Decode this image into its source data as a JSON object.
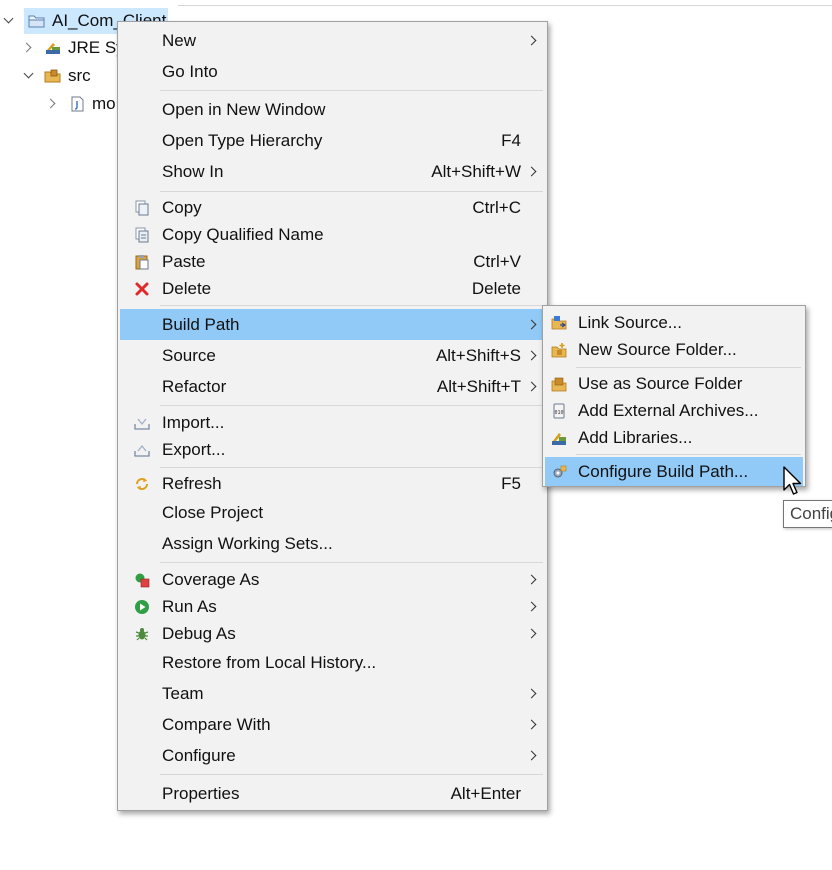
{
  "tree": {
    "items": [
      {
        "label": "AI_Com_Client",
        "expanded": true,
        "selected": true,
        "icon": "project-folder-icon"
      },
      {
        "label": "JRE Sys",
        "expanded": false,
        "icon": "jre-library-icon"
      },
      {
        "label": "src",
        "expanded": true,
        "icon": "package-folder-icon"
      },
      {
        "label": "mo",
        "expanded": false,
        "icon": "java-file-icon"
      }
    ]
  },
  "context_menu": {
    "items": [
      {
        "label": "New",
        "shortcut": "",
        "submenu": true
      },
      {
        "label": "Go Into",
        "shortcut": ""
      },
      {
        "label": "Open in New Window",
        "shortcut": ""
      },
      {
        "label": "Open Type Hierarchy",
        "shortcut": "F4"
      },
      {
        "label": "Show In",
        "shortcut": "Alt+Shift+W",
        "submenu": true
      },
      {
        "label": "Copy",
        "shortcut": "Ctrl+C",
        "icon": "copy-icon"
      },
      {
        "label": "Copy Qualified Name",
        "shortcut": "",
        "icon": "copy-qualified-name-icon"
      },
      {
        "label": "Paste",
        "shortcut": "Ctrl+V",
        "icon": "paste-icon"
      },
      {
        "label": "Delete",
        "shortcut": "Delete",
        "icon": "delete-icon"
      },
      {
        "label": "Build Path",
        "shortcut": "",
        "submenu": true,
        "highlighted": true
      },
      {
        "label": "Source",
        "shortcut": "Alt+Shift+S",
        "submenu": true
      },
      {
        "label": "Refactor",
        "shortcut": "Alt+Shift+T",
        "submenu": true
      },
      {
        "label": "Import...",
        "shortcut": "",
        "icon": "import-icon"
      },
      {
        "label": "Export...",
        "shortcut": "",
        "icon": "export-icon"
      },
      {
        "label": "Refresh",
        "shortcut": "F5",
        "icon": "refresh-icon"
      },
      {
        "label": "Close Project",
        "shortcut": ""
      },
      {
        "label": "Assign Working Sets...",
        "shortcut": ""
      },
      {
        "label": "Coverage As",
        "shortcut": "",
        "submenu": true,
        "icon": "coverage-icon"
      },
      {
        "label": "Run As",
        "shortcut": "",
        "submenu": true,
        "icon": "run-icon"
      },
      {
        "label": "Debug As",
        "shortcut": "",
        "submenu": true,
        "icon": "debug-icon"
      },
      {
        "label": "Restore from Local History...",
        "shortcut": ""
      },
      {
        "label": "Team",
        "shortcut": "",
        "submenu": true
      },
      {
        "label": "Compare With",
        "shortcut": "",
        "submenu": true
      },
      {
        "label": "Configure",
        "shortcut": "",
        "submenu": true
      },
      {
        "label": "Properties",
        "shortcut": "Alt+Enter"
      }
    ]
  },
  "build_path_submenu": {
    "items": [
      {
        "label": "Link Source...",
        "icon": "link-source-icon"
      },
      {
        "label": "New Source Folder...",
        "icon": "new-source-folder-icon"
      },
      {
        "label": "Use as Source Folder",
        "icon": "use-as-source-folder-icon"
      },
      {
        "label": "Add External Archives...",
        "icon": "external-archive-icon"
      },
      {
        "label": "Add Libraries...",
        "icon": "library-icon"
      },
      {
        "label": "Configure Build Path...",
        "icon": "configure-build-path-icon",
        "highlighted": true
      }
    ]
  },
  "tooltip": {
    "text": "Configure Build Path"
  },
  "colors": {
    "menu_background": "#f2f2f2",
    "highlight": "#91c9f7",
    "tree_selection": "#cce8ff",
    "delete_red": "#e02a2a",
    "run_green": "#2f9e44"
  }
}
